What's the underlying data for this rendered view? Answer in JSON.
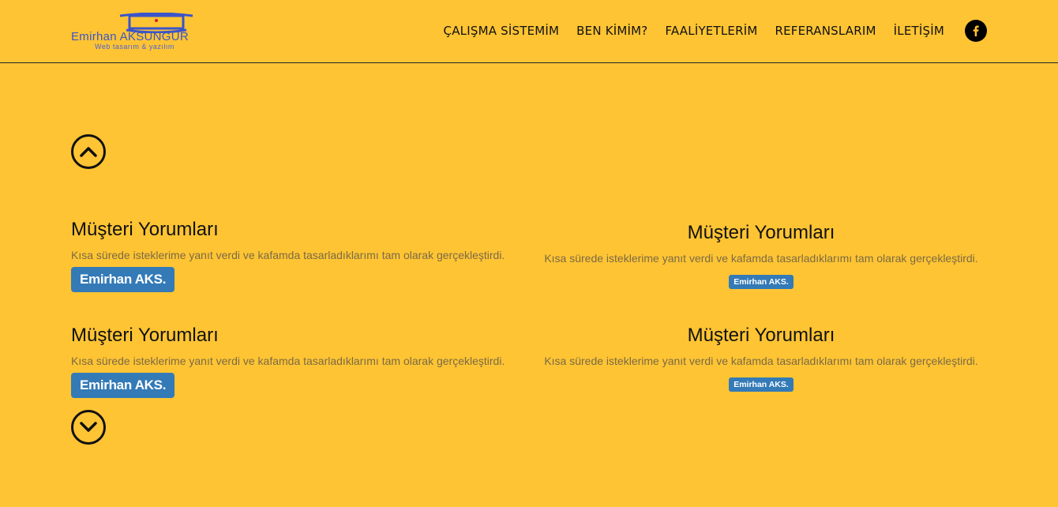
{
  "header": {
    "logo": {
      "name": "Emirhan AKSUNGUR",
      "tagline": "Web tasarım & yazılım"
    },
    "nav": [
      {
        "label": "ÇALIŞMA SİSTEMİM"
      },
      {
        "label": "BEN KİMİM?"
      },
      {
        "label": "FAALİYETLERİM"
      },
      {
        "label": "REFERANSLARIM"
      },
      {
        "label": "İLETİŞİM"
      }
    ],
    "social_icon": "facebook-icon"
  },
  "slider": {
    "up_icon": "chevron-up-icon",
    "down_icon": "chevron-down-icon"
  },
  "reviews": [
    {
      "title": "Müşteri Yorumları",
      "text": "Kısa sürede isteklerime yanıt verdi ve kafamda tasarladıklarımı tam olarak gerçekleştirdi.",
      "author": "Emirhan AKS."
    },
    {
      "title": "Müşteri Yorumları",
      "text": "Kısa sürede isteklerime yanıt verdi ve kafamda tasarladıklarımı tam olarak gerçekleştirdi.",
      "author": "Emirhan AKS."
    },
    {
      "title": "Müşteri Yorumları",
      "text": "Kısa sürede isteklerime yanıt verdi ve kafamda tasarladıklarımı tam olarak gerçekleştirdi.",
      "author": "Emirhan AKS."
    },
    {
      "title": "Müşteri Yorumları",
      "text": "Kısa sürede isteklerime yanıt verdi ve kafamda tasarladıklarımı tam olarak gerçekleştirdi.",
      "author": "Emirhan AKS."
    }
  ],
  "colors": {
    "background": "#ffc433",
    "badge": "#337ab7",
    "logo_blue": "#3b55c8"
  }
}
